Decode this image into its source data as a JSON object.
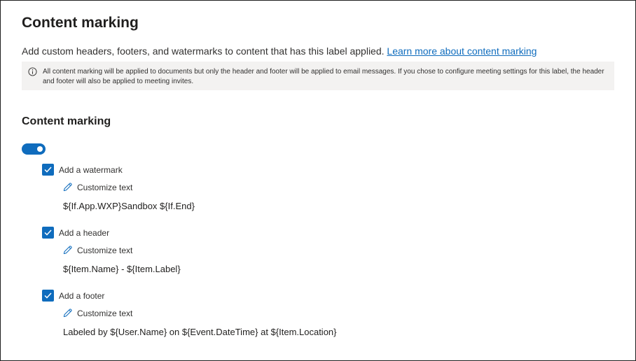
{
  "page": {
    "title": "Content marking",
    "description": "Add custom headers, footers, and watermarks to content that has this label applied. ",
    "learn_more_link": "Learn more about content marking",
    "info_message": "All content marking will be applied to documents but only the header and footer will be applied to email messages. If you chose to configure meeting settings for this label, the header and footer will also be applied to meeting invites."
  },
  "section": {
    "title": "Content marking",
    "toggle_on": true
  },
  "options": [
    {
      "label": "Add a watermark",
      "checked": true,
      "customize_label": "Customize text",
      "text": "${If.App.WXP}Sandbox ${If.End}"
    },
    {
      "label": "Add a header",
      "checked": true,
      "customize_label": "Customize text",
      "text": "${Item.Name} - ${Item.Label}"
    },
    {
      "label": "Add a footer",
      "checked": true,
      "customize_label": "Customize text",
      "text": "Labeled by ${User.Name} on ${Event.DateTime} at ${Item.Location}"
    }
  ],
  "colors": {
    "accent": "#0f6cbd",
    "info_background": "#f3f2f1"
  },
  "icons": {
    "info": "info-icon",
    "edit": "pencil-icon",
    "check": "checkmark-icon"
  }
}
